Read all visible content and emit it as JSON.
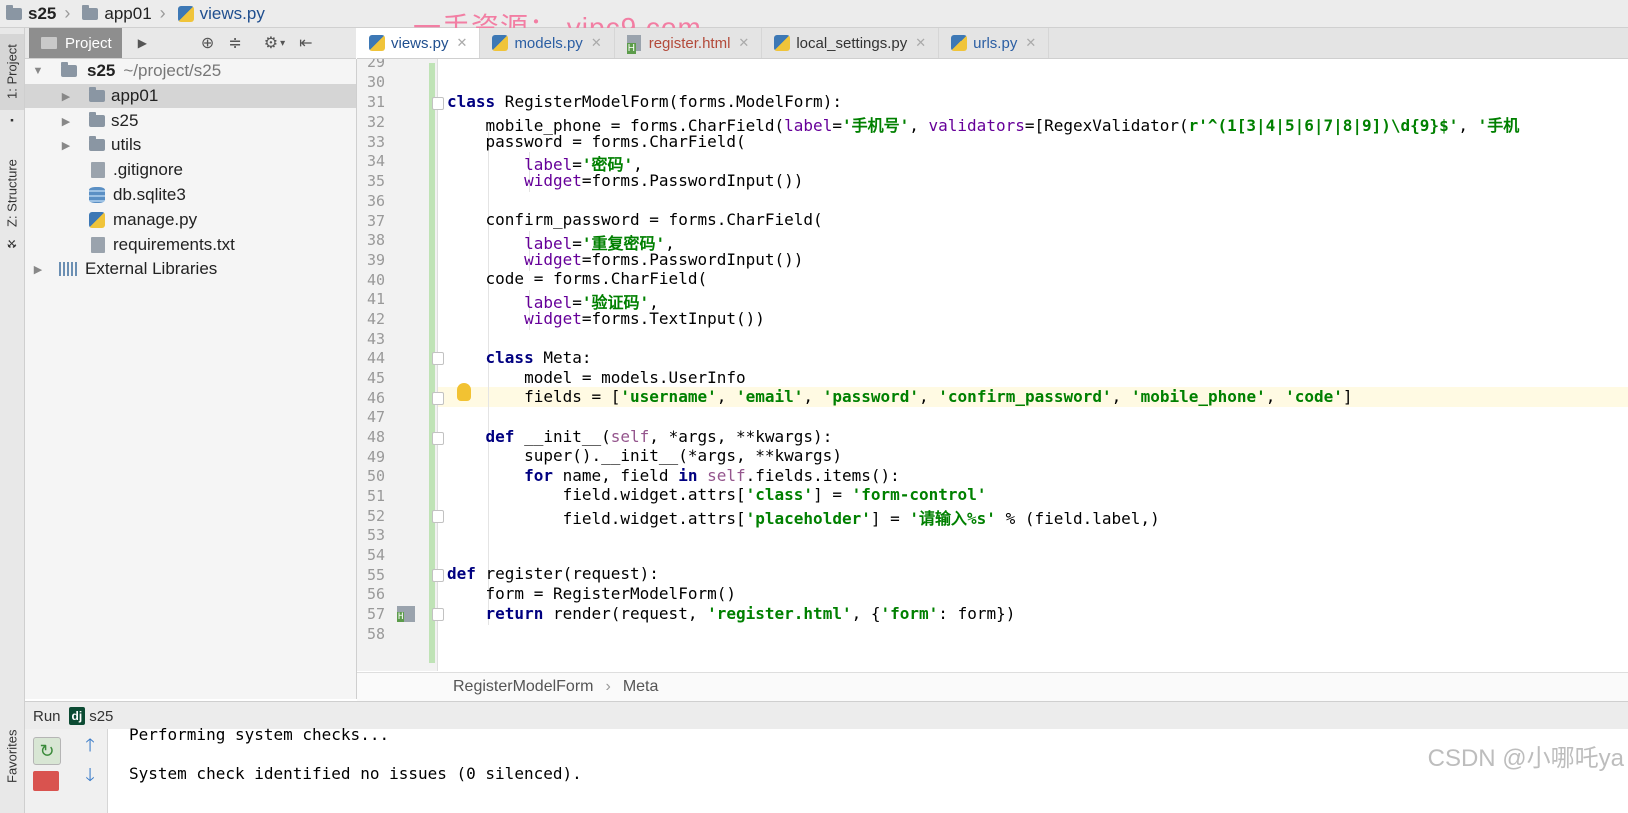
{
  "crumbs": [
    {
      "label": "s25",
      "bold": true
    },
    {
      "label": "app01"
    },
    {
      "label": "views.py",
      "file": true
    }
  ],
  "watermark": "一手资源： vipc9.com",
  "leftstrip": {
    "project": "1: Project",
    "structure": "Z: Structure",
    "favorites": "Favorites"
  },
  "project_panel": {
    "tab_label": "Project",
    "tree": [
      {
        "label": "s25",
        "suffix": "~/project/s25",
        "type": "root-folder"
      },
      {
        "label": "app01",
        "type": "folder",
        "selected": true
      },
      {
        "label": "s25",
        "type": "folder"
      },
      {
        "label": "utils",
        "type": "folder"
      },
      {
        "label": ".gitignore",
        "type": "file"
      },
      {
        "label": "db.sqlite3",
        "type": "db"
      },
      {
        "label": "manage.py",
        "type": "py"
      },
      {
        "label": "requirements.txt",
        "type": "file"
      },
      {
        "label": "External Libraries",
        "type": "lib"
      }
    ]
  },
  "editor_tabs": [
    {
      "label": "views.py",
      "active": true
    },
    {
      "label": "models.py"
    },
    {
      "label": "register.html",
      "html": true
    },
    {
      "label": "local_settings.py"
    },
    {
      "label": "urls.py"
    }
  ],
  "code": {
    "line_numbers": [
      "29",
      "30",
      "31",
      "32",
      "33",
      "34",
      "35",
      "36",
      "37",
      "38",
      "39",
      "40",
      "41",
      "42",
      "43",
      "44",
      "45",
      "46",
      "47",
      "48",
      "49",
      "50",
      "51",
      "52",
      "53",
      "54",
      "55",
      "56",
      "57",
      "58"
    ],
    "strings": {
      "l31_class": "class",
      "l31_rest": " RegisterModelForm(forms.ModelForm):",
      "l32_a": "    mobile_phone = forms.CharField(",
      "l32_label": "label",
      "l32_eq": "=",
      "l32_s1": "'手机号'",
      "l32_b": ", ",
      "l32_val": "validators",
      "l32_c": "=[RegexValidator(",
      "l32_s2": "r'^(1[3|4|5|6|7|8|9])\\d{9}$'",
      "l32_d": ", ",
      "l32_s3": "'手机",
      "l33": "    password = forms.CharField(",
      "l34_a": "        ",
      "l34_label": "label",
      "l34_eq": "=",
      "l34_s": "'密码'",
      "l34_b": ",",
      "l35_a": "        ",
      "l35_w": "widget",
      "l35_b": "=forms.PasswordInput())",
      "l37": "    confirm_password = forms.CharField(",
      "l38_a": "        ",
      "l38_label": "label",
      "l38_eq": "=",
      "l38_s": "'重复密码'",
      "l38_b": ",",
      "l39_a": "        ",
      "l39_w": "widget",
      "l39_b": "=forms.PasswordInput())",
      "l40": "    code = forms.CharField(",
      "l41_a": "        ",
      "l41_label": "label",
      "l41_eq": "=",
      "l41_s": "'验证码'",
      "l41_b": ",",
      "l42_a": "        ",
      "l42_w": "widget",
      "l42_b": "=forms.TextInput())",
      "l44_a": "    ",
      "l44_class": "class",
      "l44_b": " Meta:",
      "l45": "        model = models.UserInfo",
      "l46_a": "        fields = [",
      "l46_s1": "'username'",
      "l46_c1": ", ",
      "l46_s2": "'email'",
      "l46_c2": ", ",
      "l46_s3": "'password'",
      "l46_c3": ", ",
      "l46_s4": "'confirm_password'",
      "l46_c4": ", ",
      "l46_s5": "'mobile_phone'",
      "l46_c5": ", ",
      "l46_s6": "'code'",
      "l46_e": "]",
      "l48_a": "    ",
      "l48_def": "def",
      "l48_b": " __init__(",
      "l48_self": "self",
      "l48_c": ", *args, **kwargs):",
      "l49": "        super().__init__(*args, **kwargs)",
      "l50_a": "        ",
      "l50_for": "for",
      "l50_b": " name, field ",
      "l50_in": "in",
      "l50_c": " ",
      "l50_self": "self",
      "l50_d": ".fields.items():",
      "l51_a": "            field.widget.attrs[",
      "l51_s1": "'class'",
      "l51_b": "] = ",
      "l51_s2": "'form-control'",
      "l52_a": "            field.widget.attrs[",
      "l52_s1": "'placeholder'",
      "l52_b": "] = ",
      "l52_s2": "'请输入%s'",
      "l52_c": " % (field.label,)",
      "l55_def": "def",
      "l55_b": " register(request):",
      "l56": "    form = RegisterModelForm()",
      "l57_a": "    ",
      "l57_ret": "return",
      "l57_b": " render(request, ",
      "l57_s1": "'register.html'",
      "l57_c": ", {",
      "l57_s2": "'form'",
      "l57_d": ": form})"
    }
  },
  "editor_breadcrumb": {
    "first": "RegisterModelForm",
    "second": "Meta"
  },
  "run_panel": {
    "title": "Run",
    "config": "s25",
    "console": [
      "Performing system checks...",
      "System check identified no issues (0 silenced)."
    ]
  },
  "csdn_watermark": "CSDN @小哪吒ya",
  "colors": {
    "keyword": "#000080",
    "string": "#008000",
    "kwarg": "#660099",
    "self": "#94558d",
    "changebar": "#bfe3b6"
  }
}
